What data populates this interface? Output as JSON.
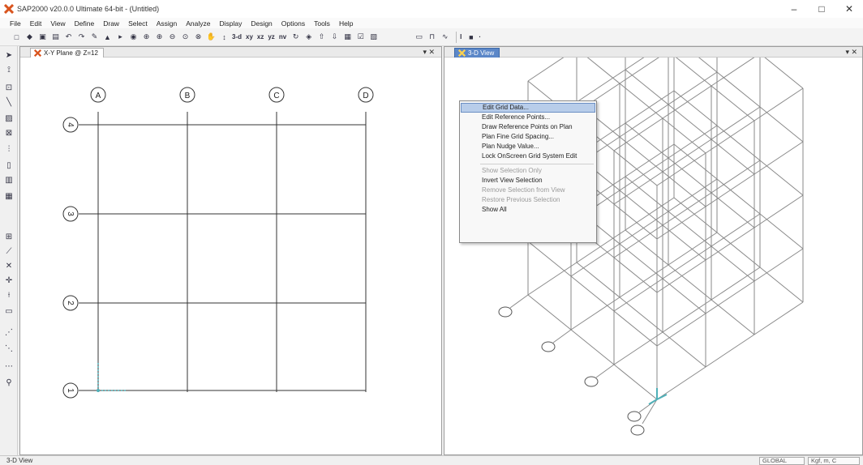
{
  "window": {
    "title": "SAP2000 v20.0.0 Ultimate 64-bit - (Untitled)",
    "controls": [
      "–",
      "□",
      "✕"
    ]
  },
  "menu": [
    "File",
    "Edit",
    "View",
    "Define",
    "Draw",
    "Select",
    "Assign",
    "Analyze",
    "Display",
    "Design",
    "Options",
    "Tools",
    "Help"
  ],
  "toolbar": {
    "view_buttons": [
      "3-d",
      "xy",
      "xz",
      "yz",
      "nv"
    ],
    "right_text": [
      "I",
      "·"
    ]
  },
  "left_pane": {
    "tab_title": "X-Y Plane @ Z=12",
    "close": "▾ ✕",
    "grid_columns": [
      "A",
      "B",
      "C",
      "D"
    ],
    "grid_rows": [
      "4",
      "3",
      "2",
      "1"
    ]
  },
  "right_pane": {
    "tab_title": "3-D View",
    "close": "▾ ✕"
  },
  "context_menu": {
    "items": [
      {
        "label": "Edit Grid Data...",
        "state": "highlighted"
      },
      {
        "label": "Edit Reference Points...",
        "state": "enabled"
      },
      {
        "label": "Draw Reference Points on Plan",
        "state": "enabled"
      },
      {
        "label": "Plan Fine Grid Spacing...",
        "state": "enabled"
      },
      {
        "label": "Plan Nudge Value...",
        "state": "enabled"
      },
      {
        "label": "Lock OnScreen Grid System Edit",
        "state": "enabled"
      },
      {
        "label": "Show Selection Only",
        "state": "disabled"
      },
      {
        "label": "Invert View Selection",
        "state": "enabled"
      },
      {
        "label": "Remove Selection from View",
        "state": "disabled"
      },
      {
        "label": "Restore Previous Selection",
        "state": "disabled"
      },
      {
        "label": "Show All",
        "state": "enabled"
      }
    ]
  },
  "status": {
    "left": "3-D View",
    "coord_system": "GLOBAL",
    "units": "Kgf, m, C"
  },
  "icons": {
    "app_logo": "sap2000-logo-icon",
    "toolbar": [
      "new-file-icon",
      "open-icon",
      "save-icon",
      "print-icon",
      "undo-icon",
      "redo-icon",
      "pencil-icon",
      "lock-icon",
      "run-icon",
      "run-analysis-icon",
      "zoom-window-icon",
      "zoom-in-icon",
      "zoom-out-icon",
      "zoom-fit-icon",
      "zoom-prev-icon",
      "pan-icon",
      "grid-icon"
    ]
  },
  "colors": {
    "active_tab": "#5b87c8",
    "menu_highlight": "#b8cdea",
    "grid_lines": "#333333",
    "model_lines": "#8a8a8a",
    "support_marker": "#4fb0b8"
  }
}
